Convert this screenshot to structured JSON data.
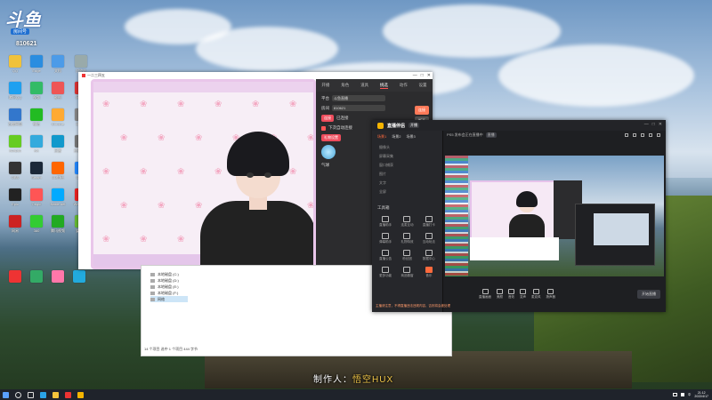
{
  "overlay": {
    "brand": "斗鱼",
    "room_tag": "房间号",
    "room_number": "810621",
    "credit_prefix": "制作人：",
    "credit_name": "悟空HUX"
  },
  "vtuber_app": {
    "title": "一二三四五",
    "window_controls": [
      "—",
      "□",
      "✕"
    ],
    "tabs": [
      "开播",
      "角色",
      "道具",
      "挑选",
      "动作",
      "设置"
    ],
    "active_tab": "挑选",
    "platform_label": "平台",
    "platform_value": "斗鱼直播",
    "room_label": "房间",
    "room_value": "810621",
    "connect_button": "连接",
    "side_buttons": [
      "连接",
      "断开"
    ],
    "checkbox_label": "下次自动连接",
    "status_button": "已连接",
    "gift_button": "礼物设置",
    "item_label": "气球"
  },
  "file_explorer": {
    "drives": [
      "本地磁盘 (C:)",
      "本地磁盘 (D:)",
      "本地磁盘 (E:)",
      "本地磁盘 (F:)",
      "网络"
    ],
    "selected": "网络",
    "status": "14 个项目   选中 1 个项目  444 字节"
  },
  "streaming_app": {
    "name": "直播伴侣",
    "badge": "开播",
    "window_controls": [
      "—",
      "□",
      "✕"
    ],
    "left_tabs": [
      "场景1",
      "场景2",
      "场景3"
    ],
    "sources": [
      "摄像头",
      "屏幕采集",
      "窗口捕获",
      "图片",
      "文字",
      "全屏"
    ],
    "tools_title": "工具箱",
    "tools": [
      "直播助手",
      "连麦互动",
      "直播打卡",
      "弹幕助手",
      "礼物特效",
      "互动玩法",
      "直播公告",
      "粉丝团",
      "数据中心",
      "更多功能",
      "商品橱窗",
      "音乐"
    ],
    "notice": "主播请注意，不得直播违法违规内容，否则将会被处理",
    "live_title": "PS5 发布会正在直播中",
    "live_badge": "直播",
    "bottom_buttons": [
      "直播画面",
      "美颜",
      "音效",
      "变声",
      "麦克风",
      "扬声器"
    ],
    "go_live": "开始直播"
  },
  "taskbar": {
    "time": "21:12",
    "date": "2022/4/17",
    "lang": "中"
  },
  "desktop_icons": [
    {
      "label": "QQ"
    },
    {
      "label": "Edge"
    },
    {
      "label": "文档"
    },
    {
      "label": "回收站"
    },
    {
      "label": "腾讯QQ"
    },
    {
      "label": "视频"
    },
    {
      "label": "截图"
    },
    {
      "label": "网易云"
    },
    {
      "label": "百度网盘"
    },
    {
      "label": "微信"
    },
    {
      "label": "Chrome"
    },
    {
      "label": "计算器"
    },
    {
      "label": "NVIDIA"
    },
    {
      "label": "KK"
    },
    {
      "label": "迅雷"
    },
    {
      "label": "控制面板"
    },
    {
      "label": "OBS"
    },
    {
      "label": "Steam"
    },
    {
      "label": "UU加速"
    },
    {
      "label": "Uplay"
    },
    {
      "label": "Epic"
    },
    {
      "label": "Origin"
    },
    {
      "label": "Battle.net"
    },
    {
      "label": "WeGame"
    },
    {
      "label": "网易"
    },
    {
      "label": "360"
    },
    {
      "label": "腾讯视频"
    },
    {
      "label": "爱奇艺"
    }
  ]
}
